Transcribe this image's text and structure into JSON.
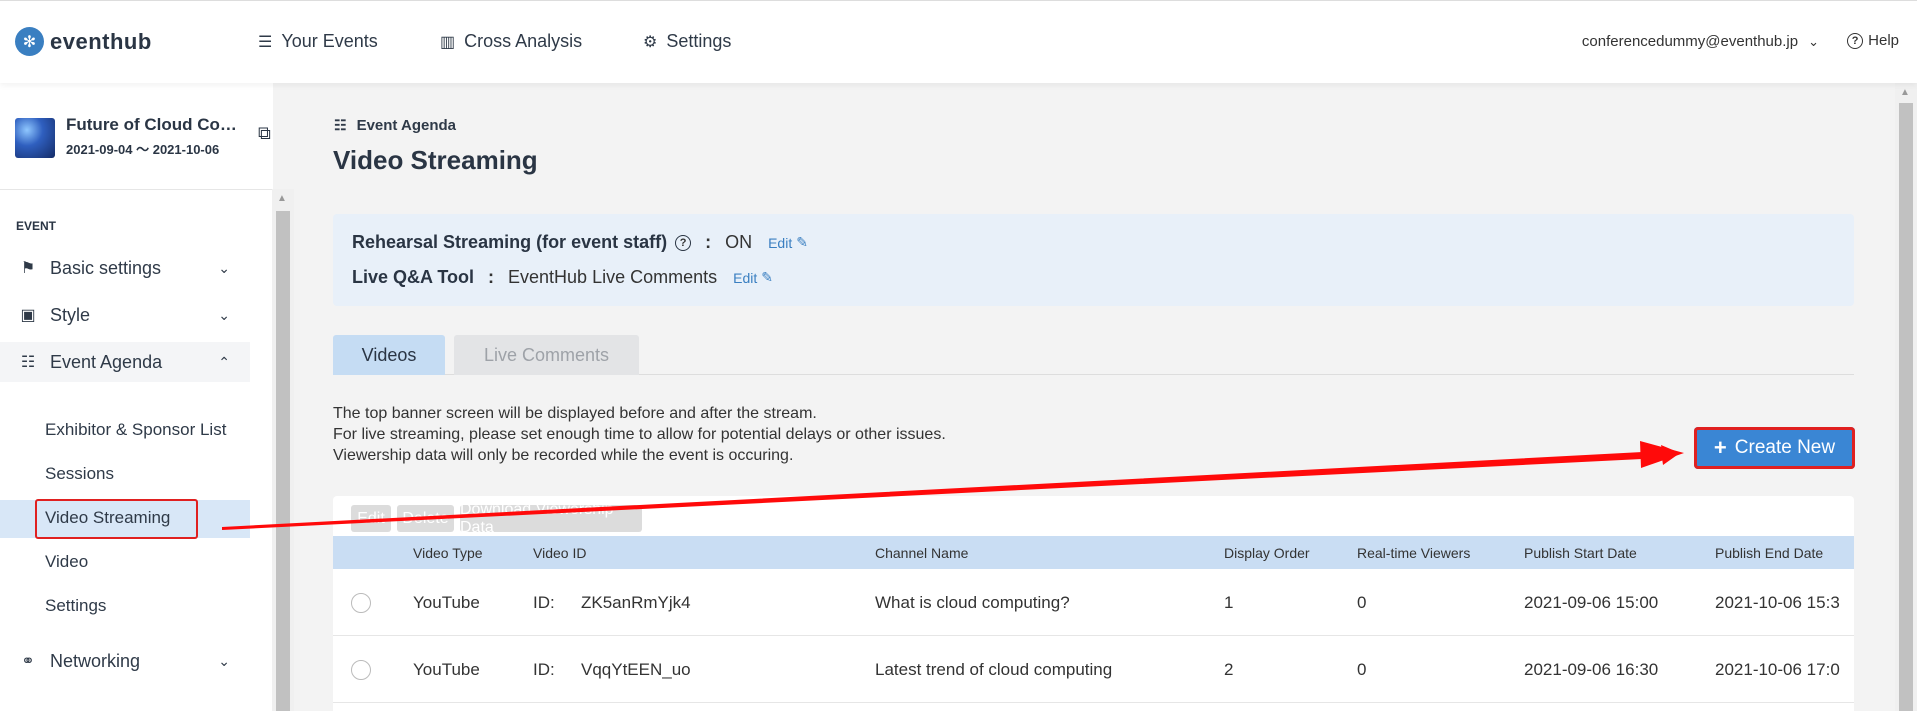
{
  "topbar": {
    "logo_text": "eventhub",
    "nav": [
      {
        "label": "Your Events",
        "icon": "list-icon"
      },
      {
        "label": "Cross Analysis",
        "icon": "bar-chart-icon"
      },
      {
        "label": "Settings",
        "icon": "gear-icon"
      }
    ],
    "account_email": "conferencedummy@eventhub.jp",
    "help_label": "Help"
  },
  "sidebar": {
    "event_name": "Future of Cloud Co…",
    "event_dates": "2021-09-04 ～ 2021-10-06",
    "section_label": "EVENT",
    "menu": {
      "basic_settings": "Basic settings",
      "style": "Style",
      "event_agenda": "Event Agenda",
      "networking": "Networking"
    },
    "sub_items": {
      "exhibitor": "Exhibitor & Sponsor List",
      "sessions": "Sessions",
      "video_streaming": "Video Streaming",
      "video": "Video",
      "settings": "Settings"
    }
  },
  "main": {
    "breadcrumb": "Event Agenda",
    "title": "Video Streaming",
    "info": {
      "rehearsal_label": "Rehearsal Streaming (for event staff)",
      "rehearsal_value": "ON",
      "qa_label": "Live Q&A Tool",
      "qa_value": "EventHub Live Comments",
      "colon": ":",
      "edit_label": "Edit"
    },
    "tabs": {
      "videos": "Videos",
      "live_comments": "Live Comments"
    },
    "notes": {
      "line1": "The top banner screen will be displayed before and after the stream.",
      "line2": "For live streaming, please set enough time to allow for potential delays or other issues.",
      "line3": "Viewership data will only be recorded while the event is occuring."
    },
    "create_new": "Create New",
    "table_buttons": {
      "edit": "Edit",
      "delete": "Delete",
      "download": "Download Viewership Data"
    },
    "table": {
      "headers": [
        "Video Type",
        "Video ID",
        "Channel Name",
        "Display Order",
        "Real-time Viewers",
        "Publish Start Date",
        "Publish End Date"
      ],
      "id_prefix": "ID:",
      "rows": [
        {
          "type": "YouTube",
          "video_id": "ZK5anRmYjk4",
          "channel": "What is cloud computing?",
          "order": "1",
          "viewers": "0",
          "start": "2021-09-06 15:00",
          "end": "2021-10-06 15:3"
        },
        {
          "type": "YouTube",
          "video_id": "VqqYtEEN_uo",
          "channel": "Latest trend of cloud computing",
          "order": "2",
          "viewers": "0",
          "start": "2021-09-06 16:30",
          "end": "2021-10-06 17:0"
        }
      ]
    }
  },
  "colors": {
    "accent": "#3a86d4",
    "annotation": "#e02020",
    "active_tab": "#c5dcf3",
    "info_box": "#e8f0f9"
  }
}
